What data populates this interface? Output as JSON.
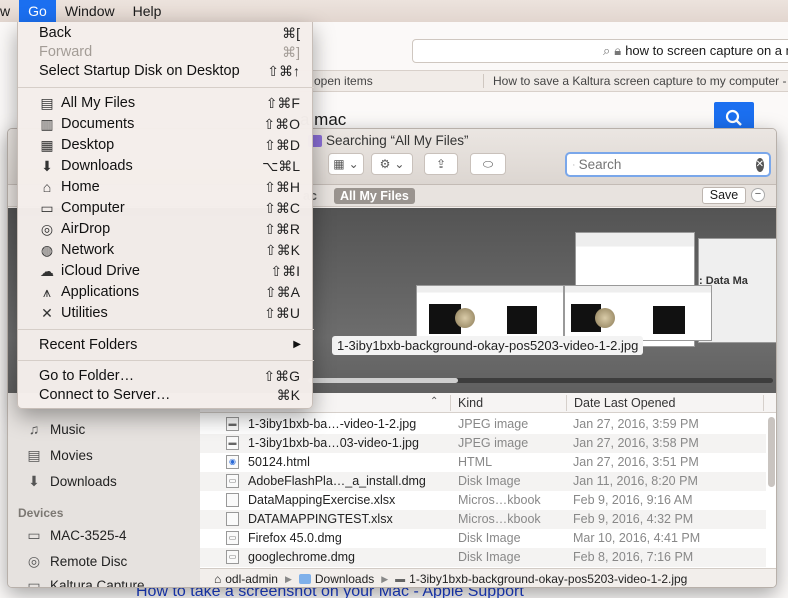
{
  "menubar": {
    "items": [
      {
        "label": "w",
        "active": false
      },
      {
        "label": "Go",
        "active": true
      },
      {
        "label": "Window",
        "active": false
      },
      {
        "label": "Help",
        "active": false
      }
    ]
  },
  "browser": {
    "address": "how to screen capture on a m",
    "tab_left": "open items",
    "tab_right": "How to save a Kaltura screen capture to my computer -",
    "query_fragment": "a mac",
    "bottom_link": "How to take a screenshot on your Mac - Apple Support",
    "accent_color": "#1b6ff0"
  },
  "go_menu": {
    "group1": [
      {
        "label": "Back",
        "shortcut": "⌘[",
        "disabled": false
      },
      {
        "label": "Forward",
        "shortcut": "⌘]",
        "disabled": true
      },
      {
        "label": "Select Startup Disk on Desktop",
        "shortcut": "⇧⌘↑",
        "disabled": false
      }
    ],
    "group2": [
      {
        "label": "All My Files",
        "shortcut": "⇧⌘F",
        "icon": "all-files-icon"
      },
      {
        "label": "Documents",
        "shortcut": "⇧⌘O",
        "icon": "documents-icon"
      },
      {
        "label": "Desktop",
        "shortcut": "⇧⌘D",
        "icon": "desktop-icon"
      },
      {
        "label": "Downloads",
        "shortcut": "⌥⌘L",
        "icon": "downloads-icon"
      },
      {
        "label": "Home",
        "shortcut": "⇧⌘H",
        "icon": "home-icon"
      },
      {
        "label": "Computer",
        "shortcut": "⇧⌘C",
        "icon": "computer-icon"
      },
      {
        "label": "AirDrop",
        "shortcut": "⇧⌘R",
        "icon": "airdrop-icon"
      },
      {
        "label": "Network",
        "shortcut": "⇧⌘K",
        "icon": "network-icon"
      },
      {
        "label": "iCloud Drive",
        "shortcut": "⇧⌘I",
        "icon": "cloud-icon"
      },
      {
        "label": "Applications",
        "shortcut": "⇧⌘A",
        "icon": "applications-icon"
      },
      {
        "label": "Utilities",
        "shortcut": "⇧⌘U",
        "icon": "utilities-icon"
      }
    ],
    "recent_folders": "Recent Folders",
    "group4": [
      {
        "label": "Go to Folder…",
        "shortcut": "⇧⌘G"
      },
      {
        "label": "Connect to Server…",
        "shortcut": "⌘K"
      }
    ]
  },
  "finder": {
    "title": "Searching “All My Files”",
    "search_placeholder": "Search",
    "scope_mac": "ac",
    "scope_all": "All My Files",
    "save_label": "Save",
    "minus_label": "−",
    "coverflow_caption": "1-3iby1bxb-background-okay-pos5203-video-1-2.jpg",
    "coverflow_card_text": ": Data Ma",
    "sidebar": {
      "favorites": [
        {
          "label": "Music",
          "icon": "music-icon"
        },
        {
          "label": "Movies",
          "icon": "movies-icon"
        },
        {
          "label": "Downloads",
          "icon": "downloads-icon"
        }
      ],
      "devices_header": "Devices",
      "devices": [
        {
          "label": "MAC-3525-4",
          "icon": "drive-icon"
        },
        {
          "label": "Remote Disc",
          "icon": "disc-icon"
        },
        {
          "label": "Kaltura Capture",
          "icon": "drive-icon"
        }
      ]
    },
    "columns": {
      "kind": "Kind",
      "date": "Date Last Opened"
    },
    "rows": [
      {
        "name": "1-3iby1bxb-ba…-video-1-2.jpg",
        "kind": "JPEG image",
        "date": "Jan 27, 2016, 3:59 PM"
      },
      {
        "name": "1-3iby1bxb-ba…03-video-1.jpg",
        "kind": "JPEG image",
        "date": "Jan 27, 2016, 3:58 PM"
      },
      {
        "name": "50124.html",
        "kind": "HTML",
        "date": "Jan 27, 2016, 3:51 PM"
      },
      {
        "name": "AdobeFlashPla…_a_install.dmg",
        "kind": "Disk Image",
        "date": "Jan 11, 2016, 8:20 PM"
      },
      {
        "name": "DataMappingExercise.xlsx",
        "kind": "Micros…kbook",
        "date": "Feb 9, 2016, 9:16 AM"
      },
      {
        "name": "DATAMAPPINGTEST.xlsx",
        "kind": "Micros…kbook",
        "date": "Feb 9, 2016, 4:32 PM"
      },
      {
        "name": "Firefox 45.0.dmg",
        "kind": "Disk Image",
        "date": "Mar 10, 2016, 4:41 PM"
      },
      {
        "name": "googlechrome.dmg",
        "kind": "Disk Image",
        "date": "Feb 8, 2016, 7:16 PM"
      }
    ],
    "path": {
      "user": "odl-admin",
      "folder": "Downloads",
      "file": "1-3iby1bxb-background-okay-pos5203-video-1-2.jpg"
    }
  }
}
